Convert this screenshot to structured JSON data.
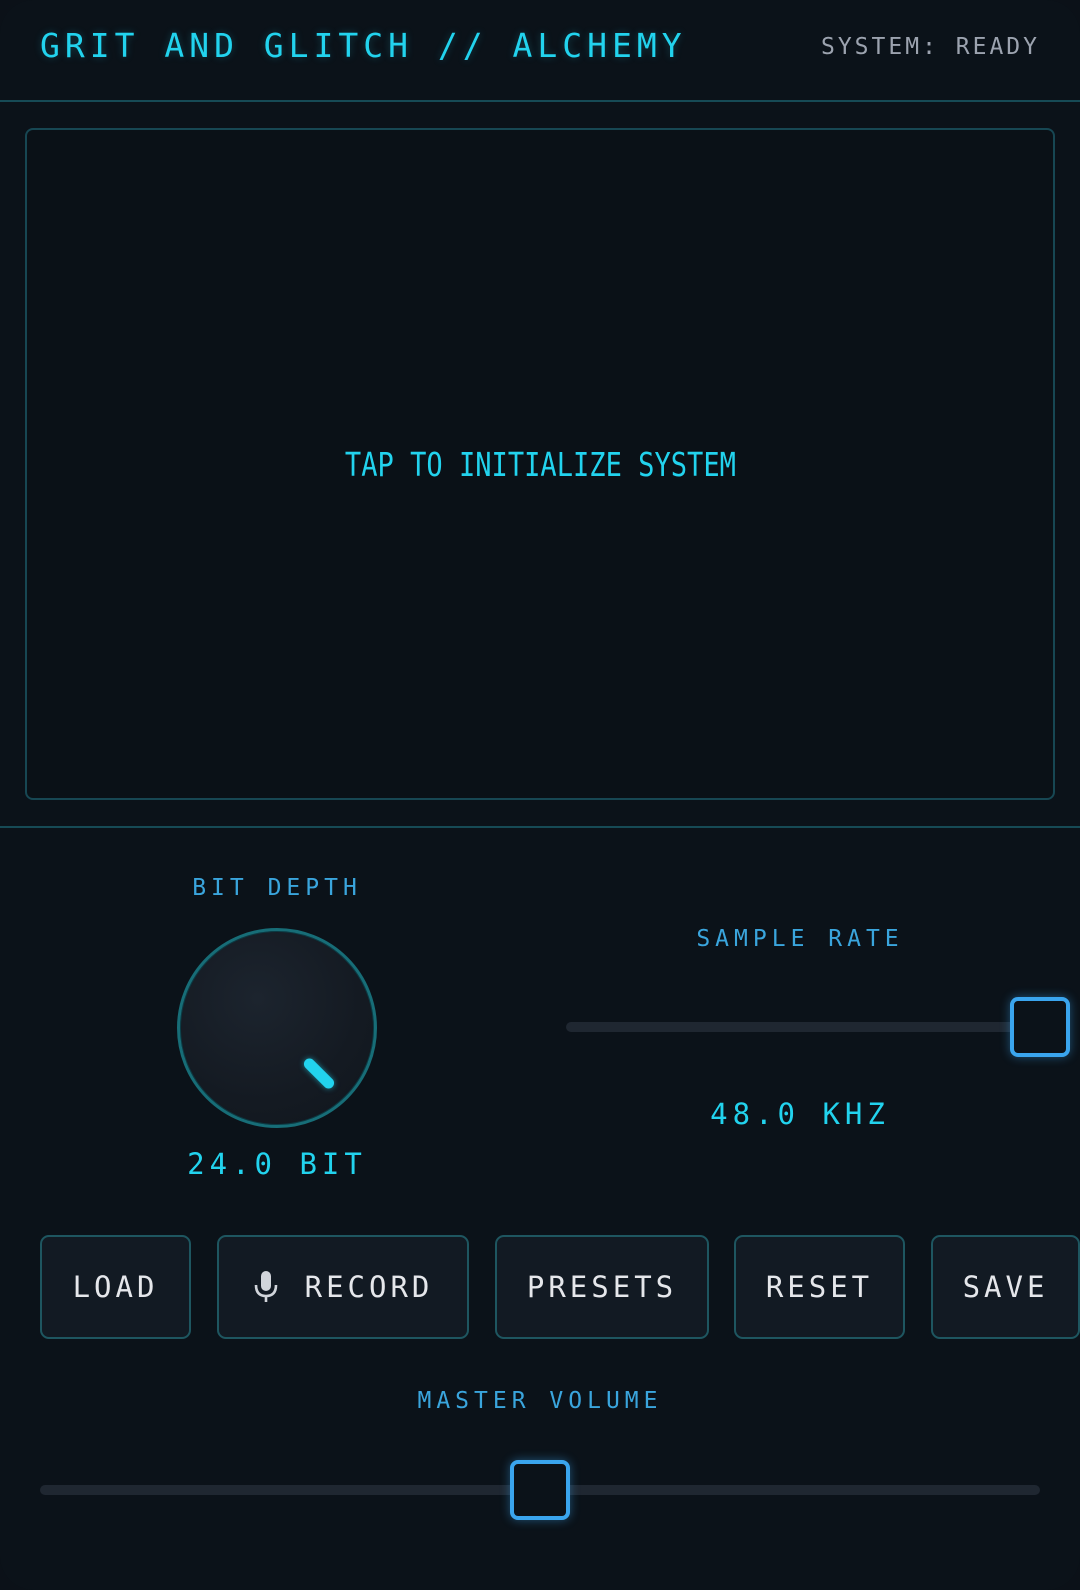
{
  "header": {
    "title": "GRIT AND GLITCH // ALCHEMY",
    "status": "SYSTEM: READY"
  },
  "display": {
    "prompt": "TAP TO INITIALIZE SYSTEM"
  },
  "bit_depth": {
    "label": "BIT DEPTH",
    "value_text": "24.0 BIT",
    "value": 24.0
  },
  "sample_rate": {
    "label": "SAMPLE RATE",
    "value_text": "48.0 KHZ",
    "value": 48.0,
    "level": 1.0
  },
  "buttons": {
    "load": "LOAD",
    "record": "RECORD",
    "presets": "PRESETS",
    "reset": "RESET",
    "save": "SAVE"
  },
  "master_volume": {
    "label": "MASTER VOLUME",
    "level": 0.5
  },
  "icons": {
    "record": "microphone-icon"
  },
  "colors": {
    "accent": "#22d3ee",
    "label": "#3aa5dd",
    "slider_thumb": "#3aa5ee",
    "background": "#0b1219"
  }
}
